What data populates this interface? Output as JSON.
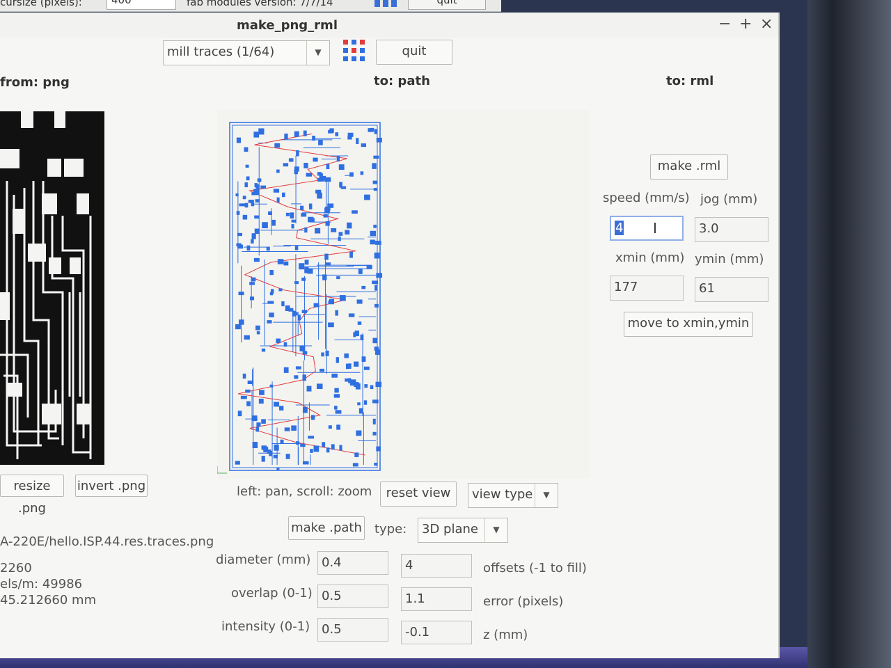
{
  "background_window": {
    "cursor_label": "cursize (pixels):",
    "cursor_value": "400",
    "version_label": "fab modules version: 7/7/14",
    "quit_label": "quit"
  },
  "window": {
    "title": "make_png_rml",
    "minimize": "−",
    "maximize": "+",
    "close": "×"
  },
  "toolbar": {
    "process_selected": "mill traces (1/64)",
    "quit_label": "quit"
  },
  "headers": {
    "from": "from: png",
    "to_path": "to: path",
    "to_rml": "to: rml"
  },
  "png_panel": {
    "resize_label": "resize .png",
    "invert_label": "invert .png",
    "file_path": "A-220E/hello.ISP.44.res.traces.png",
    "info_line1": "2260",
    "info_line2": "els/m: 49986",
    "info_line3": "45.212660 mm"
  },
  "path_panel": {
    "hint": "left: pan, scroll: zoom",
    "reset_view_label": "reset view",
    "view_type_label": "view type",
    "make_path_label": "make .path",
    "type_label": "type:",
    "type_value": "3D plane",
    "diameter_label": "diameter (mm)",
    "diameter_value": "0.4",
    "offsets_value": "4",
    "offsets_label": "offsets (-1 to fill)",
    "overlap_label": "overlap (0-1)",
    "overlap_value": "0.5",
    "error_value": "1.1",
    "error_label": "error (pixels)",
    "intensity_label": "intensity (0-1)",
    "intensity_value": "0.5",
    "z_value": "-0.1",
    "z_label": "z (mm)"
  },
  "rml_panel": {
    "make_rml_label": "make .rml",
    "speed_label": "speed (mm/s)",
    "speed_value": "4",
    "jog_label": "jog (mm)",
    "jog_value": "3.0",
    "xmin_label": "xmin (mm)",
    "xmin_value": "177",
    "ymin_label": "ymin (mm)",
    "ymin_value": "61",
    "move_label": "move to xmin,ymin"
  },
  "colors": {
    "path_blue": "#2f6fe0",
    "path_red": "#e23b3b",
    "window_bg": "#f6f6f4"
  }
}
